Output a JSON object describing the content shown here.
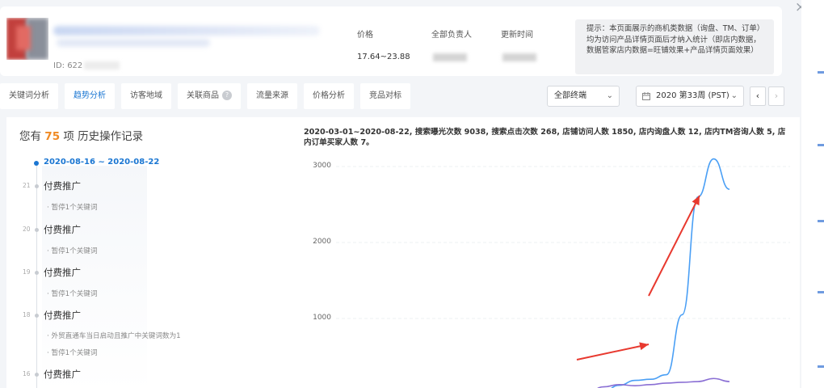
{
  "close_icon": "×",
  "product": {
    "id_label": "ID: 622"
  },
  "header_cols": {
    "price": {
      "label": "价格",
      "value": "17.64~23.88"
    },
    "owner": {
      "label": "全部负责人"
    },
    "updated": {
      "label": "更新时间"
    }
  },
  "tip": "提示：本页面展示的商机类数据（询盘、TM、订单）均为访问产品详情页面后才纳入统计（即店内数据，数据管家店内数据=旺铺效果+产品详情页面效果）",
  "tabs": [
    {
      "label": "关键词分析"
    },
    {
      "label": "趋势分析"
    },
    {
      "label": "访客地域"
    },
    {
      "label": "关联商品"
    },
    {
      "label": "流量来源"
    },
    {
      "label": "价格分析"
    },
    {
      "label": "竞品对标"
    }
  ],
  "help_icon": "?",
  "terminal_select": {
    "value": "全部终端"
  },
  "week_select": {
    "value": "2020 第33周 (PST)"
  },
  "history": {
    "prefix": "您有 ",
    "count": "75",
    "suffix": " 项 历史操作记录",
    "current_range": "2020-08-16 ~ 2020-08-22",
    "entries": [
      {
        "day": "21",
        "title": "付费推广",
        "items": [
          "暂停1个关键词"
        ]
      },
      {
        "day": "20",
        "title": "付费推广",
        "items": [
          "暂停1个关键词"
        ]
      },
      {
        "day": "19",
        "title": "付费推广",
        "items": [
          "暂停1个关键词"
        ]
      },
      {
        "day": "18",
        "title": "付费推广",
        "items": [
          "外贸直通车当日启动且推广中关键词数为1",
          "暂停1个关键词"
        ]
      },
      {
        "day": "16",
        "title": "付费推广",
        "items": []
      }
    ]
  },
  "summary": "2020-03-01~2020-08-22, 搜索曝光次数 9038, 搜索点击次数 268, 店铺访问人数 1850, 店内询盘人数 12, 店内TM咨询人数 5, 店内订单买家人数 7。",
  "chart_data": {
    "type": "line",
    "y_ticks": [
      "3000",
      "2000",
      "1000"
    ],
    "ylim": [
      0,
      3000
    ],
    "colors": {
      "blue": "#4a9ff5",
      "purple": "#8a6fd4",
      "orange": "#e07a3a",
      "arrow": "#e8392f"
    },
    "series": [
      {
        "color": "blue",
        "values": [
          0,
          0,
          40,
          120,
          185,
          200,
          260,
          1050,
          2600,
          3100,
          2700
        ]
      },
      {
        "color": "purple",
        "values": [
          0,
          20,
          100,
          130,
          115,
          130,
          150,
          160,
          170,
          210,
          170
        ]
      },
      {
        "color": "orange",
        "values": [
          0,
          0,
          0,
          0,
          0,
          0,
          0,
          10,
          15,
          20,
          20
        ]
      }
    ]
  }
}
